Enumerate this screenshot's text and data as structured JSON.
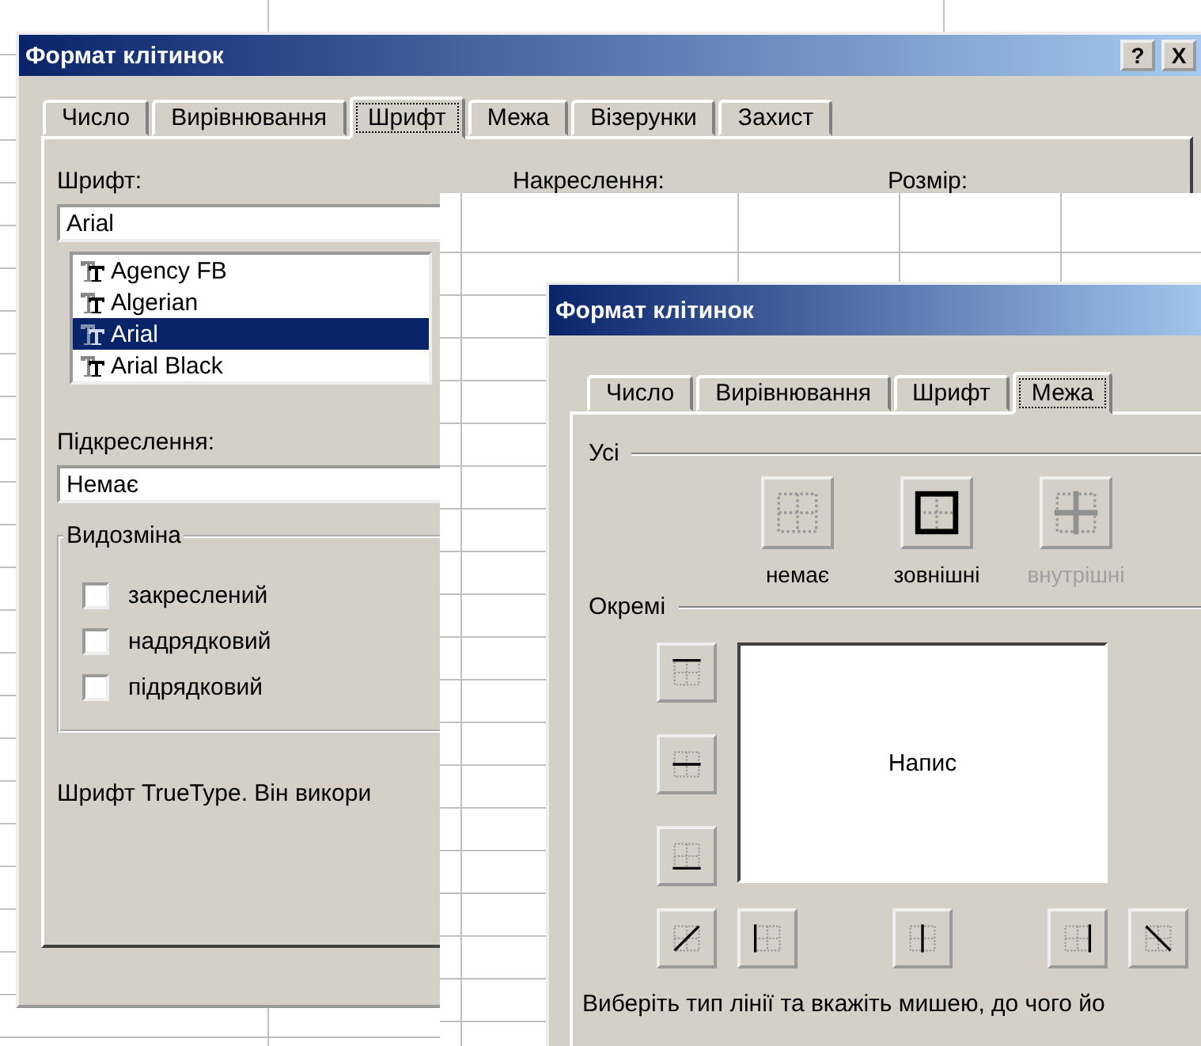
{
  "back_dialog": {
    "title": "Формат клітинок",
    "help_button": "?",
    "close_button": "X",
    "tabs": [
      {
        "label": "Число",
        "selected": false
      },
      {
        "label": "Вирівнювання",
        "selected": false
      },
      {
        "label": "Шрифт",
        "selected": true
      },
      {
        "label": "Межа",
        "selected": false
      },
      {
        "label": "Візерунки",
        "selected": false
      },
      {
        "label": "Захист",
        "selected": false
      }
    ],
    "font_label": "Шрифт:",
    "style_label": "Накреслення:",
    "size_label": "Розмір:",
    "font_value": "Arial",
    "fonts": [
      {
        "name": "Agency FB",
        "selected": false
      },
      {
        "name": "Algerian",
        "selected": false
      },
      {
        "name": "Arial",
        "selected": true
      },
      {
        "name": "Arial Black",
        "selected": false
      }
    ],
    "underline_label": "Підкреслення:",
    "underline_value": "Немає",
    "effects": {
      "title": "Видозміна",
      "options": [
        {
          "label": "закреслений",
          "checked": false
        },
        {
          "label": "надрядковий",
          "checked": false
        },
        {
          "label": "підрядковий",
          "checked": false
        }
      ]
    },
    "description": "Шрифт TrueType. Він викори"
  },
  "front_dialog": {
    "title": "Формат клітинок",
    "tabs": [
      {
        "label": "Число",
        "selected": false
      },
      {
        "label": "Вирівнювання",
        "selected": false
      },
      {
        "label": "Шрифт",
        "selected": false
      },
      {
        "label": "Межа",
        "selected": true
      }
    ],
    "presets_label": "Усі",
    "presets": [
      {
        "kind": "none",
        "label": "немає",
        "disabled": false
      },
      {
        "kind": "outline",
        "label": "зовнішні",
        "disabled": false
      },
      {
        "kind": "inside",
        "label": "внутрішні",
        "disabled": true
      }
    ],
    "individual_label": "Окремі",
    "preview_text": "Напис",
    "border_buttons": [
      {
        "kind": "top"
      },
      {
        "kind": "middle-h"
      },
      {
        "kind": "bottom"
      },
      {
        "kind": "diag-up"
      },
      {
        "kind": "left"
      },
      {
        "kind": "middle-v"
      },
      {
        "kind": "right"
      },
      {
        "kind": "diag-down"
      }
    ],
    "hint": "Виберіть тип лінії та вкажіть мишею, до чого йо"
  }
}
